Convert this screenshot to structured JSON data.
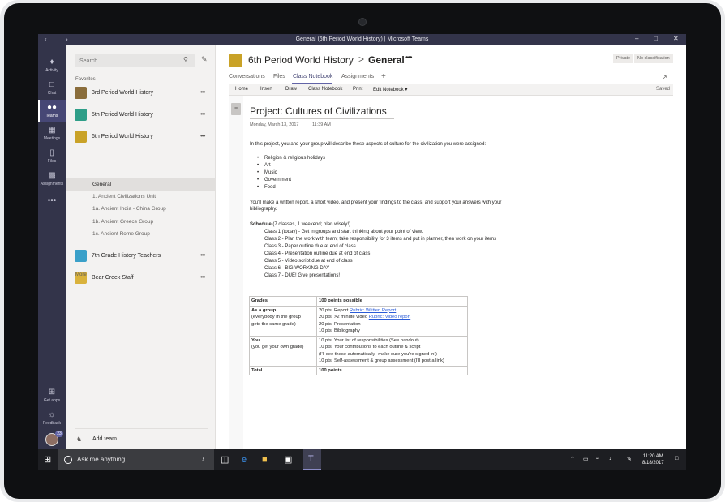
{
  "window": {
    "title": "General (6th Period World History) | Microsoft Teams"
  },
  "rail": {
    "items": [
      {
        "label": "Activity",
        "icon": "bell-icon"
      },
      {
        "label": "Chat",
        "icon": "chat-icon"
      },
      {
        "label": "Teams",
        "icon": "teams-icon"
      },
      {
        "label": "Meetings",
        "icon": "calendar-icon"
      },
      {
        "label": "Files",
        "icon": "files-icon"
      },
      {
        "label": "Assignments",
        "icon": "assignments-icon"
      }
    ],
    "more": "•••",
    "get_apps": "Get apps",
    "feedback": "Feedback",
    "avatar_badge": "23"
  },
  "panel": {
    "search_placeholder": "Search",
    "favorites_label": "Favorites",
    "teams": [
      {
        "name": "3rd Period World History",
        "color": "#8a6d3b"
      },
      {
        "name": "5th Period World History",
        "color": "#2e9e88"
      },
      {
        "name": "6th Period World History",
        "color": "#c9a227"
      },
      {
        "name": "7th Grade History Teachers",
        "color": "#3aa0c9"
      },
      {
        "name": "Bear Creek Staff",
        "color": "#d9b23c"
      }
    ],
    "channels": [
      "General",
      "1. Ancient Civilizations Unit",
      "1a. Ancient India - China Group",
      "1b. Ancient Greece Group",
      "1c. Ancient Rome Group"
    ],
    "more_label": "More",
    "add_team_label": "Add team"
  },
  "header": {
    "team": "6th Period World History",
    "separator": ">",
    "channel": "General",
    "tags": [
      "Private",
      "No classification"
    ],
    "tabs": [
      "Conversations",
      "Files",
      "Class Notebook",
      "Assignments"
    ],
    "ribbon": [
      "Home",
      "Insert",
      "Draw",
      "Class Notebook",
      "Print",
      "Edit Notebook ▾"
    ],
    "saved": "Saved"
  },
  "note": {
    "title": "Project: Cultures of Civilizations",
    "date": "Monday, March 13, 2017",
    "time": "11:39 AM",
    "intro": "In this project, you and your group will describe these aspects of culture for the civilization you were assigned:",
    "bullets": [
      "Religion & religious holidays",
      "Art",
      "Music",
      "Government",
      "Food"
    ],
    "para2_line1": "You'll make a written report, a short video, and present your findings to the class, and support your answers with your",
    "para2_line2": "bibliography.",
    "schedule_label": "Schedule",
    "schedule_note": "(7 classes, 1 weekend; plan wisely!)",
    "schedule": [
      "Class 1 (today) - Get in groups and start thinking about your point of view.",
      "Class 2 - Plan the work with team; take responsibility for 3 items and put in planner, then work on your items",
      "Class 3 - Paper outline due at end of class",
      "Class 4 - Presentation outline due at end of class",
      "Class 5 - Video script due at end of class",
      "Class 6 - BIG WORKING DAY",
      "Class 7 - DUE! Give presentations!"
    ],
    "table": {
      "h1": "Grades",
      "h2": "100 points possible",
      "group_label": "As a group",
      "group_desc1": "(everybody in the group",
      "group_desc2": "gets the same grade)",
      "g_row1_text": "20 pts: Report ",
      "g_row1_link": "Rubric: Written Report",
      "g_row2_text": "20 pts: >2 minute video ",
      "g_row2_link": "Rubric: Video report",
      "g_row3": "20 pts: Presentation",
      "g_row4": "10 pts: Bibliography",
      "you_label": "You",
      "you_desc": "(you get your own grade)",
      "y_row1": "10 pts: Your list of responsibilities (See handout)",
      "y_row2": "10 pts: Your contributions to each outline & script",
      "y_row3": "(I'll see these automatically--make sure you're signed in!)",
      "y_row4": "10 pts: Self-assessment & group assessment (I'll post a link)",
      "total_label": "Total",
      "total_value": "100 points"
    }
  },
  "taskbar": {
    "ask": "Ask me anything",
    "time": "11:20 AM",
    "date": "8/18/2017"
  }
}
